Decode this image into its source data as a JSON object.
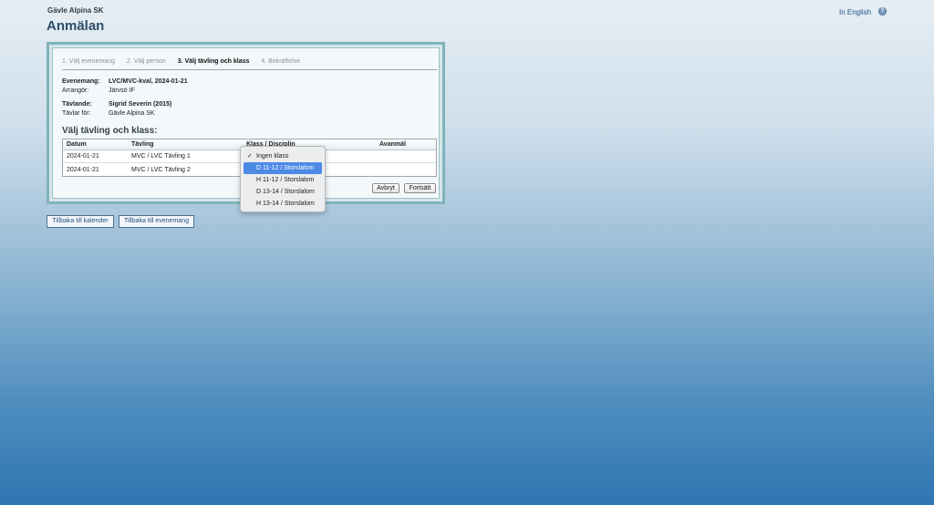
{
  "header": {
    "club": "Gävle Alpina SK",
    "title": "Anmälan",
    "lang_link": "In English",
    "help_icon": "help-icon"
  },
  "steps": [
    {
      "label": "1. Välj evenemang"
    },
    {
      "label": "2. Välj person"
    },
    {
      "label": "3. Välj tävling och klass"
    },
    {
      "label": "4. Bekräftelse"
    }
  ],
  "info": {
    "event_label": "Evenemang:",
    "event_value": "LVC/MVC-kval, 2024-01-21",
    "org_label": "Arrangör:",
    "org_value": "Järvsö IF",
    "comp_label": "Tävlande:",
    "comp_value": "Sigrid Severin (2015)",
    "club_label": "Tävlar för:",
    "club_value": "Gävle Alpina SK"
  },
  "section_title": "Välj tävling och klass:",
  "table": {
    "headers": [
      "Datum",
      "Tävling",
      "Klass / Disciplin",
      "Avanmäl"
    ],
    "rows": [
      {
        "date": "2024-01-21",
        "comp": "MVC / LVC Tävling 1"
      },
      {
        "date": "2024-01-21",
        "comp": "MVC / LVC Tävling 2"
      }
    ]
  },
  "buttons": {
    "cancel": "Avbryt",
    "continue": "Fortsätt"
  },
  "nav": {
    "calendar": "Tillbaka till kalender",
    "event": "Tillbaka till evenemang"
  },
  "dropdown": {
    "check": "✓",
    "options": [
      "Ingen klass",
      "D 11-12 / Storslalom",
      "H 11-12 / Storslalom",
      "D 13-14 / Storslalom",
      "H 13-14 / Storslalom"
    ]
  }
}
